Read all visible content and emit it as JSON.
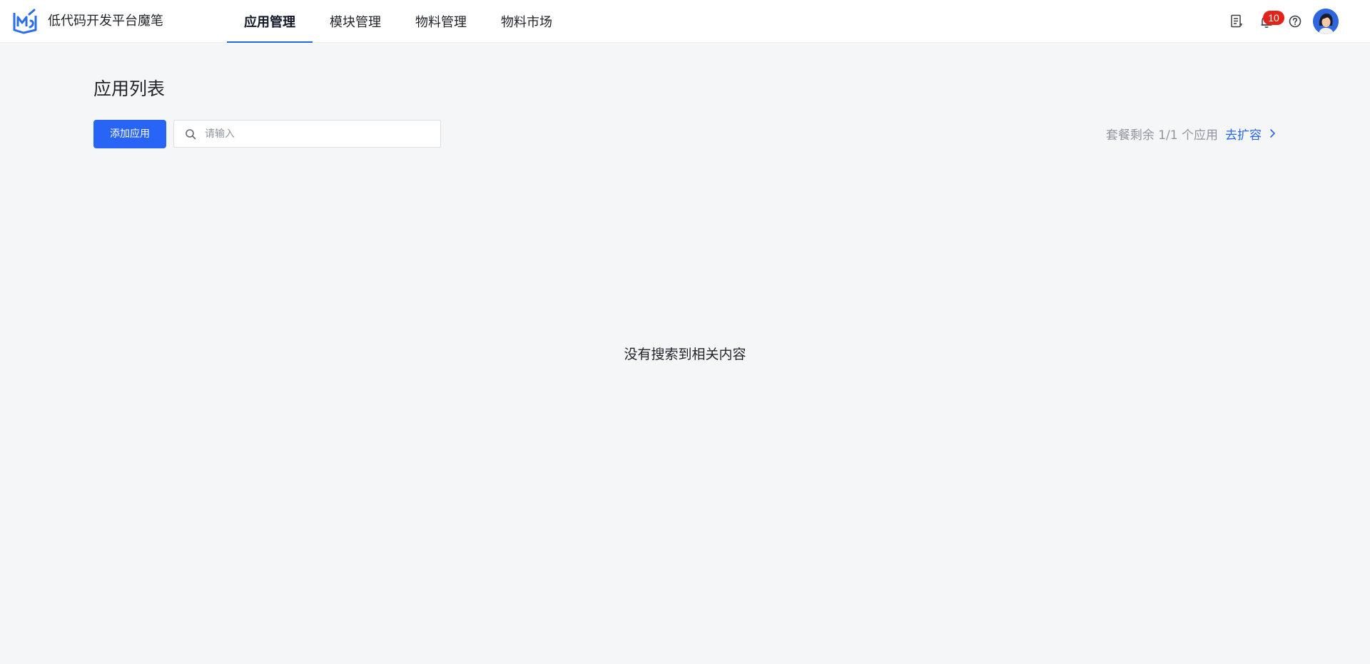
{
  "header": {
    "app_name": "低代码开发平台魔笔",
    "logo_icon": "mobi-logo-icon",
    "tabs": [
      {
        "label": "应用管理",
        "active": true
      },
      {
        "label": "模块管理",
        "active": false
      },
      {
        "label": "物料管理",
        "active": false
      },
      {
        "label": "物料市场",
        "active": false
      }
    ],
    "icons": {
      "docs": "document-icon",
      "notifications": "bell-icon",
      "help": "question-circle-icon",
      "user": "avatar"
    },
    "notification_count": "10"
  },
  "main": {
    "title": "应用列表",
    "add_button_label": "添加应用",
    "search": {
      "placeholder": "请输入",
      "value": ""
    },
    "quota": {
      "text": "套餐剩余 1/1 个应用",
      "expand_label": "去扩容"
    },
    "empty_message": "没有搜索到相关内容"
  },
  "colors": {
    "accent": "#2864f6",
    "tab_underline": "#1f6bd6",
    "badge": "#e2231a",
    "background": "#f5f6f8",
    "header_bg": "#ffffff"
  }
}
